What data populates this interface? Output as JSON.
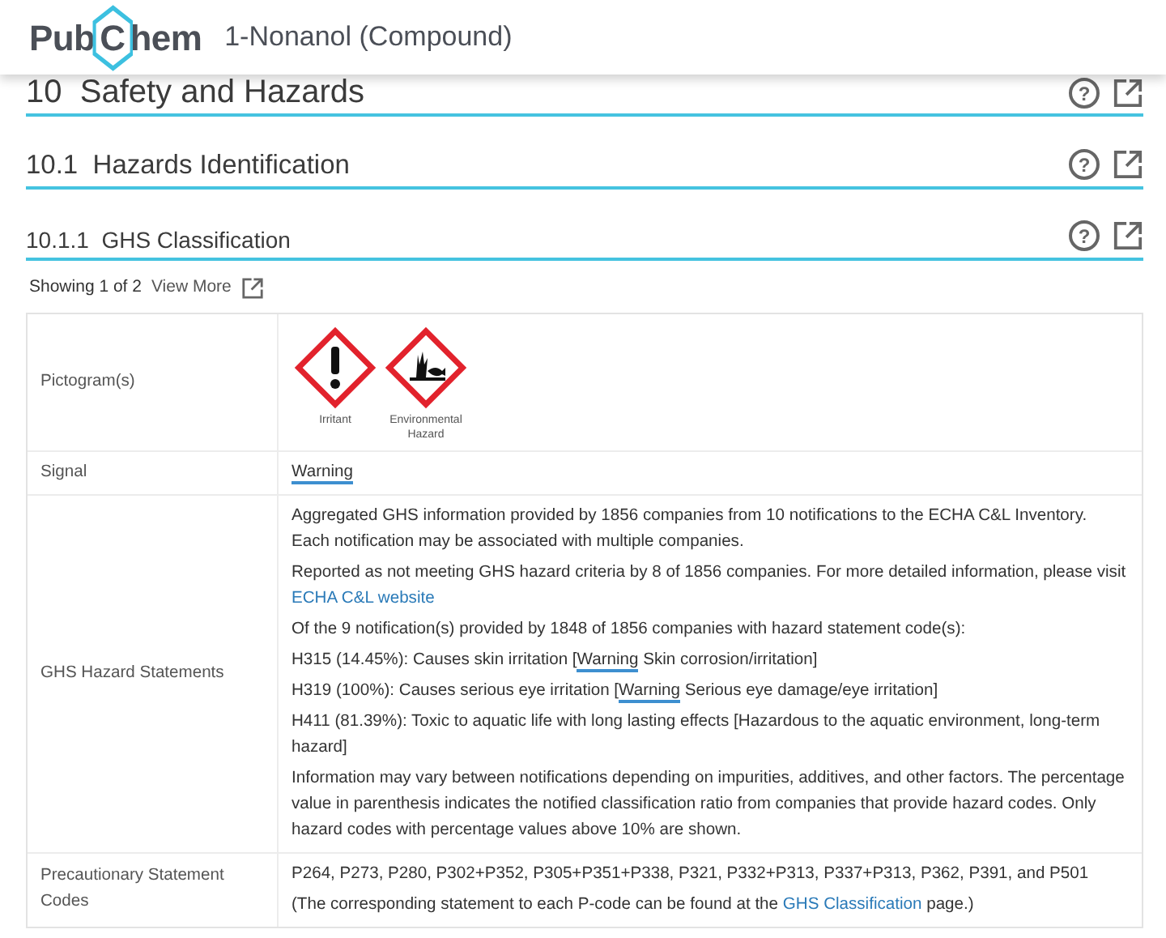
{
  "header": {
    "logo": {
      "before": "Pub",
      "mark": "C",
      "after": "hem"
    },
    "title": "1-Nonanol (Compound)"
  },
  "sections": [
    {
      "kind": "h2",
      "number": "10",
      "title": "Safety and Hazards",
      "help": "?"
    },
    {
      "kind": "h3",
      "number": "10.1",
      "title": "Hazards Identification",
      "help": "?"
    },
    {
      "kind": "h4",
      "number": "10.1.1",
      "title": "GHS Classification",
      "help": "?"
    }
  ],
  "showing": {
    "text": "Showing 1 of 2",
    "link": "View More"
  },
  "table": {
    "rows": [
      {
        "label": "Pictogram(s)",
        "kind": "pictograms",
        "pictograms": [
          {
            "kind": "exclamation",
            "caption": "Irritant"
          },
          {
            "kind": "environment",
            "caption": "Environmental Hazard"
          }
        ]
      },
      {
        "label": "Signal",
        "kind": "text",
        "paragraphs": [
          [
            {
              "kind": "signal",
              "text": "Warning"
            }
          ]
        ]
      },
      {
        "label": "GHS Hazard Statements",
        "kind": "text",
        "paragraphs": [
          [
            {
              "kind": "plain",
              "text": "Aggregated GHS information provided by 1856 companies from 10 notifications to the ECHA C&L Inventory. Each notification may be associated with multiple companies."
            }
          ],
          [
            {
              "kind": "plain",
              "text": "Reported as not meeting GHS hazard criteria by 8 of 1856 companies. For more detailed information, please visit "
            },
            {
              "kind": "link",
              "text": "ECHA C&L website"
            }
          ],
          [
            {
              "kind": "plain",
              "text": "Of the 9 notification(s) provided by 1848 of 1856 companies with hazard statement code(s):"
            }
          ],
          [
            {
              "kind": "plain",
              "text": "H315 (14.45%): Causes skin irritation ["
            },
            {
              "kind": "signal",
              "text": "Warning"
            },
            {
              "kind": "plain",
              "text": " Skin corrosion/irritation]"
            }
          ],
          [
            {
              "kind": "plain",
              "text": "H319 (100%): Causes serious eye irritation ["
            },
            {
              "kind": "signal",
              "text": "Warning"
            },
            {
              "kind": "plain",
              "text": " Serious eye damage/eye irritation]"
            }
          ],
          [
            {
              "kind": "plain",
              "text": "H411 (81.39%): Toxic to aquatic life with long lasting effects [Hazardous to the aquatic environment, long-term hazard]"
            }
          ],
          [
            {
              "kind": "plain",
              "text": "Information may vary between notifications depending on impurities, additives, and other factors. The percentage value in parenthesis indicates the notified classification ratio from companies that provide hazard codes. Only hazard codes with percentage values above 10% are shown."
            }
          ]
        ]
      },
      {
        "label": "Precautionary Statement Codes",
        "kind": "text",
        "paragraphs": [
          [
            {
              "kind": "plain",
              "text": "P264, P273, P280, P302+P352, P305+P351+P338, P321, P332+P313, P337+P313, P362, P391, and P501"
            }
          ],
          [
            {
              "kind": "plain",
              "text": "(The corresponding statement to each P-code can be found at the "
            },
            {
              "kind": "link",
              "text": "GHS Classification"
            },
            {
              "kind": "plain",
              "text": " page.)"
            }
          ]
        ]
      }
    ]
  }
}
